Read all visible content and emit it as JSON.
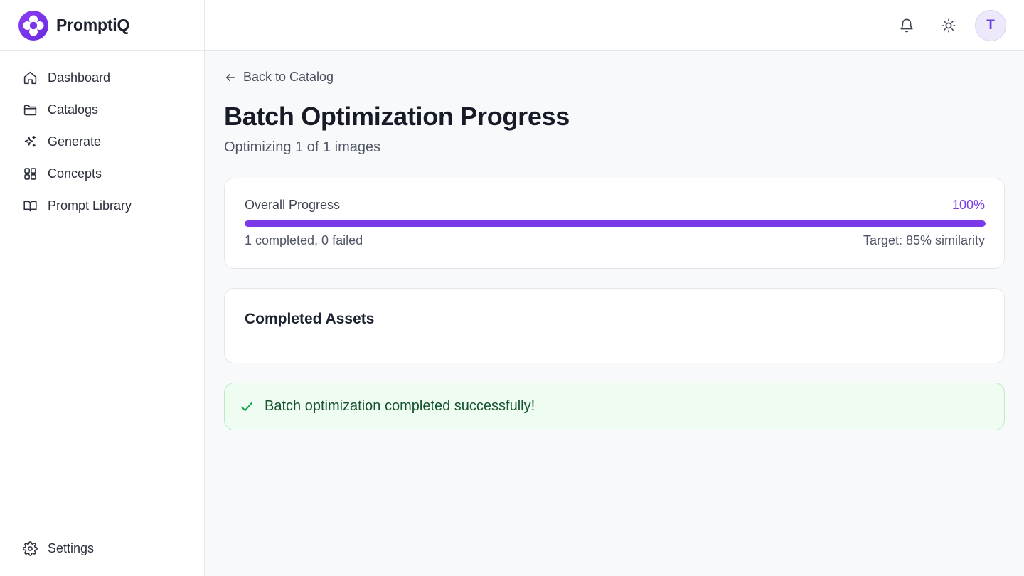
{
  "brand": {
    "name": "PromptiQ",
    "accent": "#7b3ae9"
  },
  "sidebar": {
    "items": [
      {
        "label": "Dashboard",
        "icon": "home-icon"
      },
      {
        "label": "Catalogs",
        "icon": "folder-icon"
      },
      {
        "label": "Generate",
        "icon": "sparkles-icon"
      },
      {
        "label": "Concepts",
        "icon": "grid-icon"
      },
      {
        "label": "Prompt Library",
        "icon": "book-icon"
      }
    ],
    "settings": {
      "label": "Settings",
      "icon": "gear-icon"
    }
  },
  "header": {
    "notifications_icon": "bell-icon",
    "theme_icon": "sun-icon",
    "avatar_initial": "T"
  },
  "main": {
    "back_label": "Back to Catalog",
    "title": "Batch Optimization Progress",
    "subtitle": "Optimizing 1 of 1 images",
    "progress": {
      "label": "Overall Progress",
      "percent_text": "100%",
      "percent_value": 100,
      "stats": "1 completed, 0 failed",
      "target": "Target: 85% similarity"
    },
    "assets": {
      "title": "Completed Assets"
    },
    "alert": {
      "message": "Batch optimization completed successfully!",
      "icon": "check-icon",
      "color": "#16a34a"
    }
  }
}
